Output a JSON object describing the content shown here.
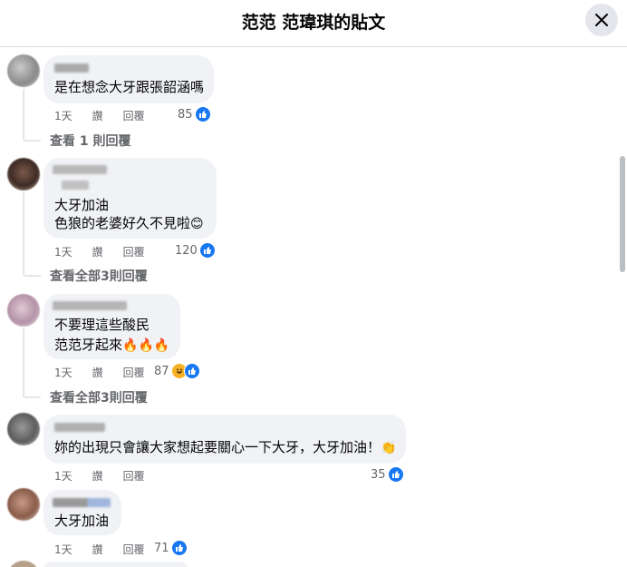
{
  "header": {
    "title": "范范 范瑋琪的貼文"
  },
  "comments": [
    {
      "text_lines": [
        "是在想念大牙跟張韶涵嗎"
      ],
      "time": "1天",
      "reply": "讚",
      "respond": "回覆",
      "likes": "85",
      "view_replies": "查看 1 則回覆"
    },
    {
      "text_lines": [
        "大牙加油",
        "色狼的老婆好久不見啦"
      ],
      "emoji": "😊",
      "time": "1天",
      "reply": "讚",
      "respond": "回覆",
      "likes": "120",
      "view_replies": "查看全部3則回覆"
    },
    {
      "text_lines": [
        "不要理這些酸民",
        "范范牙起來"
      ],
      "emoji": "🔥🔥🔥",
      "time": "1天",
      "reply": "讚",
      "respond": "回覆",
      "likes": "87",
      "view_replies": "查看全部3則回覆"
    },
    {
      "text_lines": [
        "妳的出現只會讓大家想起要關心一下大牙，大牙加油！"
      ],
      "emoji": "👏",
      "time": "1天",
      "reply": "讚",
      "respond": "回覆",
      "likes": "35"
    },
    {
      "text_lines": [
        "大牙加油"
      ],
      "time": "1天",
      "reply": "讚",
      "respond": "回覆",
      "likes": "71"
    }
  ],
  "colors": {
    "like_blue": "#1877f2",
    "bubble": "#f0f2f5",
    "meta_gray": "#65676b"
  },
  "icons": {
    "close": "close-icon",
    "like": "thumbs-up-icon",
    "haha": "haha-icon"
  }
}
